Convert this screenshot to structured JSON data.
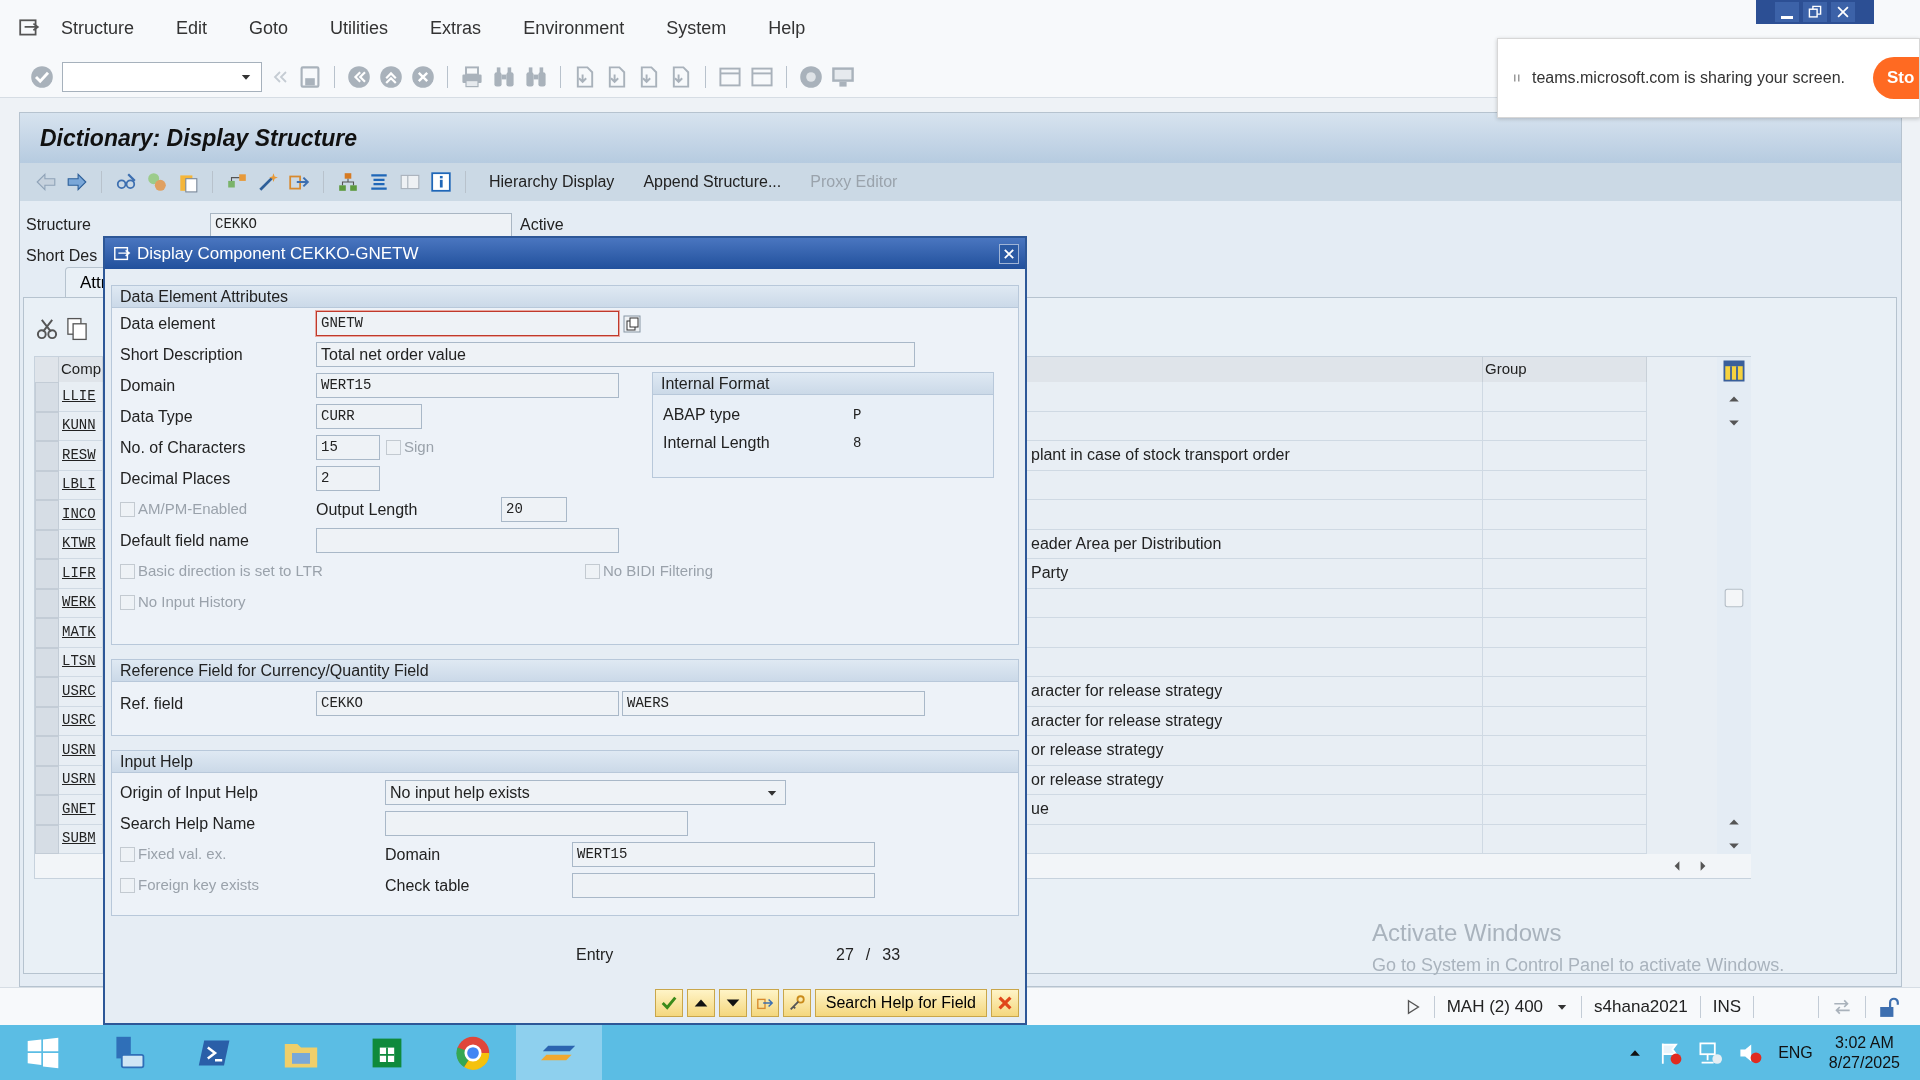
{
  "menu_bar": [
    "Structure",
    "Edit",
    "Goto",
    "Utilities",
    "Extras",
    "Environment",
    "System",
    "Help"
  ],
  "screen_title": "Dictionary: Display Structure",
  "app_toolbar": [
    {
      "label": "Hierarchy Display",
      "disabled": false
    },
    {
      "label": "Append Structure...",
      "disabled": false
    },
    {
      "label": "Proxy Editor",
      "disabled": true
    }
  ],
  "header": {
    "structure_label": "Structure",
    "structure_value": "CEKKO",
    "status": "Active",
    "short_description_label": "Short Des"
  },
  "tabs": [
    {
      "label": "Attr",
      "selected": true
    }
  ],
  "components_table": {
    "columns": [
      "Comp",
      "Group"
    ],
    "rows": [
      {
        "component": "LLIE"
      },
      {
        "component": "KUNN"
      },
      {
        "component": "RESW",
        "description": "plant in case of stock transport order"
      },
      {
        "component": "LBLI"
      },
      {
        "component": "INCO"
      },
      {
        "component": "KTWR",
        "description": "eader Area per Distribution"
      },
      {
        "component": "LIFR",
        "description": "Party"
      },
      {
        "component": "WERK"
      },
      {
        "component": "MATK"
      },
      {
        "component": "LTSN"
      },
      {
        "component": "USRC",
        "description": "aracter for release strategy"
      },
      {
        "component": "USRC",
        "description": "aracter for release strategy"
      },
      {
        "component": "USRN",
        "description": "or release strategy"
      },
      {
        "component": "USRN",
        "description": "or release strategy"
      },
      {
        "component": "GNET",
        "description": "ue"
      },
      {
        "component": "SUBM"
      }
    ]
  },
  "dialog": {
    "title": "Display Component CEKKO-GNETW",
    "data_element_section": {
      "heading": "Data Element Attributes",
      "data_element": {
        "label": "Data element",
        "value": "GNETW",
        "focused": true
      },
      "short_description": {
        "label": "Short Description",
        "value": "Total net order value"
      },
      "domain": {
        "label": "Domain",
        "value": "WERT15"
      },
      "data_type": {
        "label": "Data Type",
        "value": "CURR"
      },
      "no_of_characters": {
        "label": "No. of Characters",
        "value": "15"
      },
      "sign": {
        "label": "Sign",
        "checked": false,
        "disabled": true
      },
      "decimal_places": {
        "label": "Decimal Places",
        "value": "2"
      },
      "am_pm_enabled": {
        "label": "AM/PM-Enabled",
        "checked": false,
        "disabled": true
      },
      "output_length": {
        "label": "Output Length",
        "value": "20"
      },
      "default_field_name": {
        "label": "Default field name"
      },
      "basic_direction_ltr": {
        "label": "Basic direction is set to LTR",
        "checked": false,
        "disabled": true
      },
      "no_bidi_filtering": {
        "label": "No BIDI Filtering",
        "checked": false,
        "disabled": true
      },
      "no_input_history": {
        "label": "No Input History",
        "checked": false,
        "disabled": true
      },
      "internal_format": {
        "heading": "Internal Format",
        "abap_type": {
          "label": "ABAP type",
          "value": "P"
        },
        "internal_length": {
          "label": "Internal Length",
          "value": "8"
        }
      }
    },
    "reference_section": {
      "heading": "Reference Field for Currency/Quantity Field",
      "ref_field": {
        "label": "Ref. field",
        "table": "CEKKO",
        "field": "WAERS"
      }
    },
    "input_help_section": {
      "heading": "Input Help",
      "origin": {
        "label": "Origin of Input Help",
        "value": "No input help exists"
      },
      "search_help_name": {
        "label": "Search Help Name"
      },
      "fixed_values": {
        "label": "Fixed val. ex.",
        "checked": false,
        "disabled": true
      },
      "domain": {
        "label": "Domain",
        "value": "WERT15"
      },
      "foreign_key": {
        "label": "Foreign key exists",
        "checked": false,
        "disabled": true
      },
      "check_table": {
        "label": "Check table"
      }
    },
    "entry": {
      "label": "Entry",
      "current": "27",
      "separator": "/",
      "total": "33"
    },
    "search_help_button": "Search Help for Field"
  },
  "status_bar": {
    "session": "MAH (2) 400",
    "server": "s4hana2021",
    "mode": "INS"
  },
  "screen_share": {
    "message": "teams.microsoft.com is sharing your screen.",
    "button": "Sto"
  },
  "activation": {
    "title": "Activate Windows",
    "message": "Go to System in Control Panel to activate Windows."
  },
  "taskbar": {
    "apps": [
      {
        "kind": "server",
        "selected": false
      },
      {
        "kind": "terminal",
        "selected": false
      },
      {
        "kind": "folder",
        "selected": false
      },
      {
        "kind": "store",
        "selected": false
      },
      {
        "kind": "browser",
        "selected": false
      },
      {
        "kind": "sap",
        "selected": true
      }
    ],
    "language": "ENG",
    "time": "3:02 AM",
    "date": "8/27/2025"
  }
}
